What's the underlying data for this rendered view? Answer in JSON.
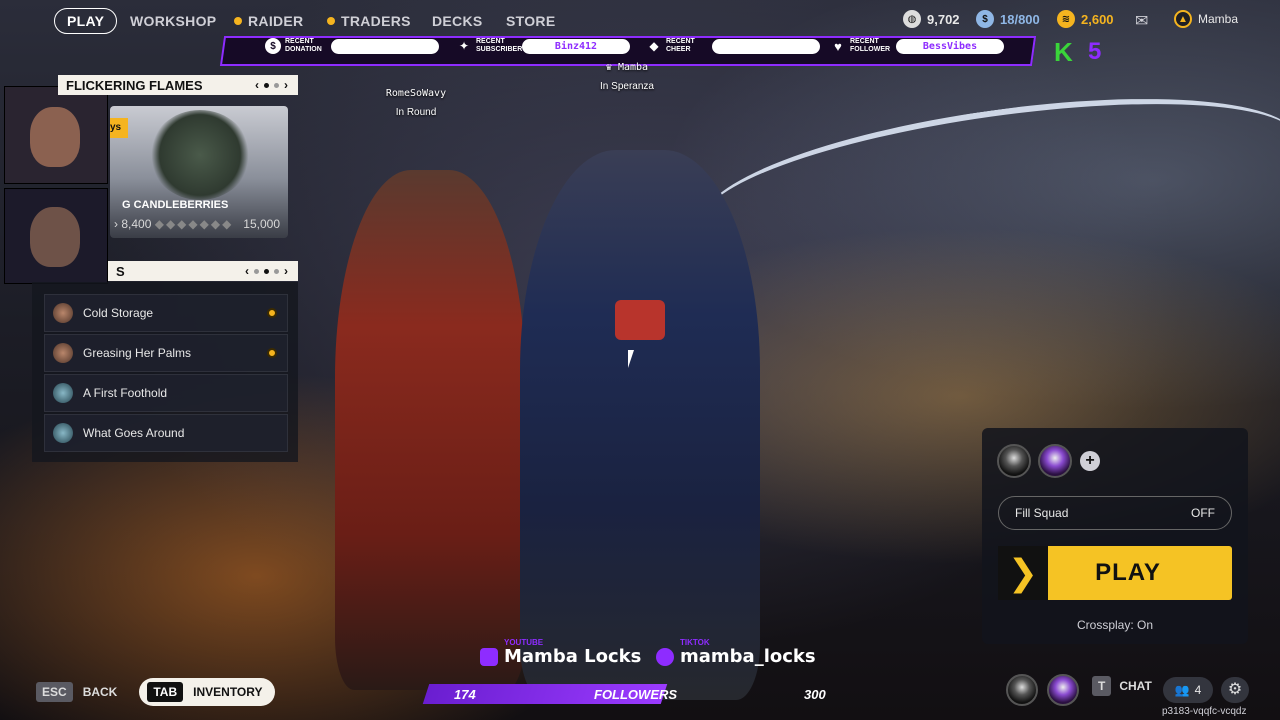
{
  "nav": {
    "play": "PLAY",
    "workshop": "WORKSHOP",
    "raider": "RAIDER",
    "traders": "TRADERS",
    "decks": "DECKS",
    "store": "STORE"
  },
  "currency": {
    "coins": "9,702",
    "tokens": "18/800",
    "credits": "2,600"
  },
  "user": {
    "name": "Mamba"
  },
  "stream_bar": {
    "donation_label": "RECENT DONATION",
    "donation_value": "",
    "subscriber_label": "RECENT SUBSCRIBER",
    "subscriber_value": "Binz412",
    "cheer_label": "RECENT CHEER",
    "cheer_value": "",
    "follower_label": "RECENT FOLLOWER",
    "follower_value": "BessVibes",
    "kick_count": "5"
  },
  "players": [
    {
      "name": "Mamba",
      "status": "In Speranza"
    },
    {
      "name": "RomeSoWavy",
      "status": "In Round"
    }
  ],
  "event_panel": {
    "title": "FLICKERING FLAMES",
    "days": "ys",
    "item_name": "G CANDLEBERRIES",
    "progress_value": "8,400",
    "progress_target": "15,000"
  },
  "quests_panel": {
    "title": "S",
    "items": [
      {
        "label": "Cold Storage",
        "tracked": true
      },
      {
        "label": "Greasing Her Palms",
        "tracked": true
      },
      {
        "label": "A First Foothold",
        "tracked": false
      },
      {
        "label": "What Goes Around",
        "tracked": false
      }
    ]
  },
  "play_panel": {
    "fill_squad_label": "Fill Squad",
    "fill_squad_value": "OFF",
    "play_label": "PLAY",
    "crossplay": "Crossplay: On"
  },
  "social": {
    "youtube_tag": "YOUTUBE",
    "youtube_name": "Mamba Locks",
    "tiktok_tag": "TIKTOK",
    "tiktok_name": "mamba_locks"
  },
  "followers": {
    "current": "174",
    "label": "FOLLOWERS",
    "goal": "300",
    "progress": 0.58
  },
  "bottom": {
    "esc_key": "ESC",
    "back_label": "BACK",
    "tab_key": "TAB",
    "inventory_label": "INVENTORY",
    "chat_key": "T",
    "chat_label": "CHAT",
    "squad_count": "4",
    "build_id": "p3183-vqqfc-vcqdz"
  },
  "colors": {
    "accent_yellow": "#f5c324",
    "stream_purple": "#8e2cff",
    "kick_green": "#3ad43a"
  }
}
